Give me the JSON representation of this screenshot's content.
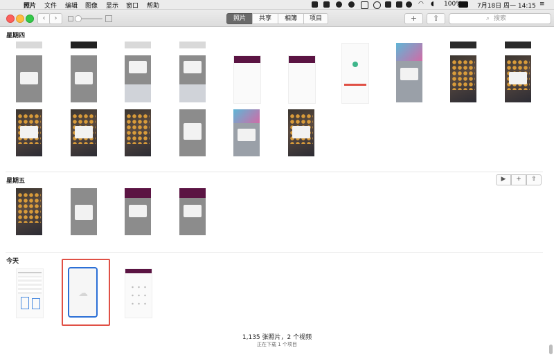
{
  "menubar": {
    "app": "照片",
    "menus": [
      "文件",
      "编辑",
      "图像",
      "显示",
      "窗口",
      "帮助"
    ],
    "battery": "100%",
    "datetime": "7月18日 周一  14:15"
  },
  "toolbar": {
    "tabs": [
      "照片",
      "共享",
      "相簿",
      "项目"
    ],
    "active_tab": "照片",
    "search_placeholder": "搜索",
    "add_symbol": "+",
    "back_symbol": "‹",
    "forward_symbol": "›"
  },
  "sections": [
    {
      "day": "星期四"
    },
    {
      "day": "星期五"
    },
    {
      "day": "今天"
    }
  ],
  "footer": {
    "summary": "1,135 张照片，2 个视频",
    "status": "正在下载 1 个项目"
  },
  "colors": {
    "accent": "#2b6fd6",
    "selection": "#e05045",
    "active_tab_bg": "#6a6a6a"
  }
}
